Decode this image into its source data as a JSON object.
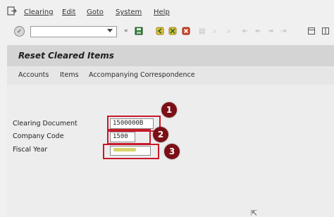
{
  "menu": {
    "items": [
      {
        "label": "Clearing"
      },
      {
        "label": "Edit"
      },
      {
        "label": "Goto"
      },
      {
        "label": "System"
      },
      {
        "label": "Help"
      }
    ]
  },
  "toolbar": {
    "command_field_value": "",
    "enter_glyph": "✓",
    "separator_glyph": "«",
    "icons": [
      "save-icon",
      "back-icon",
      "exit-icon",
      "cancel-icon",
      "print-icon",
      "find-icon",
      "layout-icon"
    ]
  },
  "page": {
    "title": "Reset Cleared Items"
  },
  "app_toolbar": {
    "buttons": [
      {
        "label": "Accounts"
      },
      {
        "label": "Items"
      },
      {
        "label": "Accompanying Correspondence"
      }
    ]
  },
  "form": {
    "clearing_document": {
      "label": "Clearing Document",
      "value": "1500000B"
    },
    "company_code": {
      "label": "Company Code",
      "value": "1500"
    },
    "fiscal_year": {
      "label": "Fiscal Year",
      "value": ""
    }
  },
  "annotations": {
    "badges": [
      "1",
      "2",
      "3"
    ],
    "highlight_color": "#c8192a",
    "badge_color": "#7a0f16"
  },
  "colors": {
    "title_strip": "#d4d4d4",
    "background": "#f0f0f0"
  }
}
